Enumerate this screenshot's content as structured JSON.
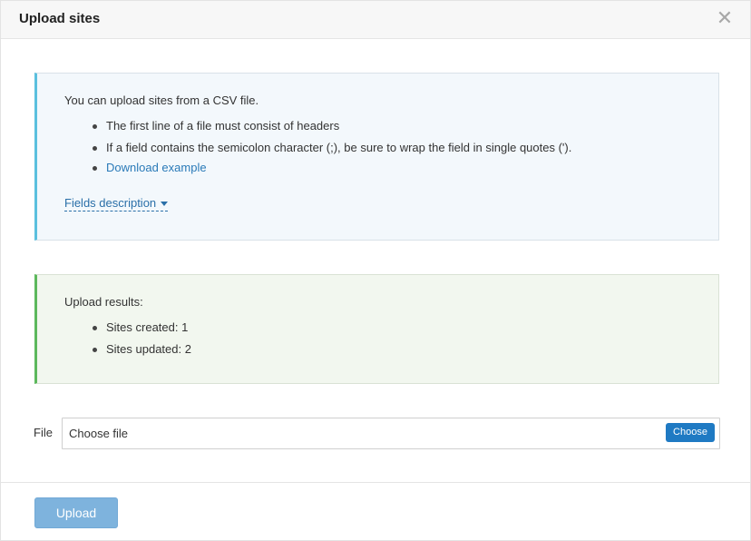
{
  "dialog": {
    "title": "Upload sites",
    "close_icon": "close-icon"
  },
  "info": {
    "intro": "You can upload sites from a CSV file.",
    "bullets": [
      "The first line of a file must consist of headers",
      "If a field contains the semicolon character (;), be sure to wrap the field in single quotes (')."
    ],
    "download_link": "Download example",
    "fields_description": "Fields description",
    "fields_description_icon": "caret-down-icon",
    "accent_color": "#5bc0de"
  },
  "results": {
    "heading": "Upload results:",
    "items": [
      "Sites created: 1",
      "Sites updated: 2"
    ],
    "accent_color": "#5cb85c"
  },
  "file": {
    "label": "File",
    "placeholder": "Choose file",
    "choose_button": "Choose"
  },
  "footer": {
    "upload_button": "Upload",
    "upload_button_color": "#7eb3dd"
  }
}
